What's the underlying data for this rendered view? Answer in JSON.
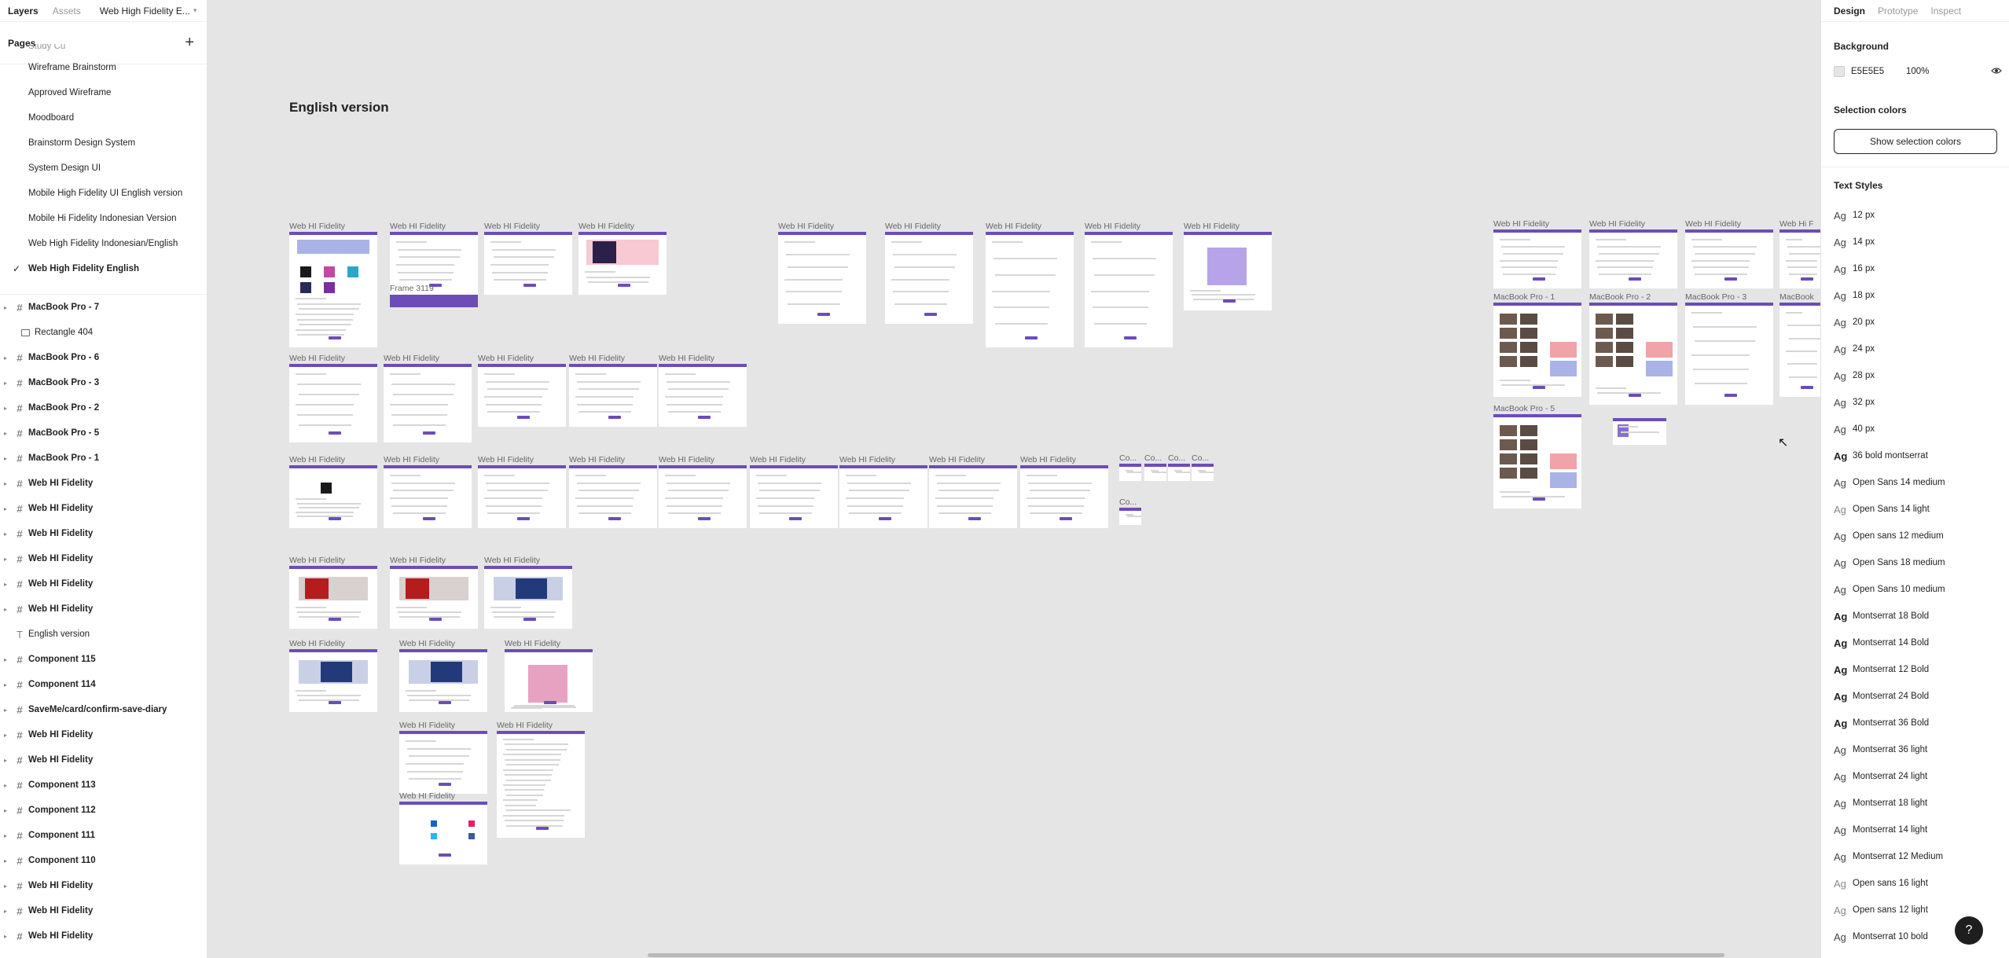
{
  "left_panel": {
    "tabs": [
      "Layers",
      "Assets"
    ],
    "file_name": "Web High Fidelity E...",
    "pages_title": "Pages",
    "pages": [
      {
        "label": "Study Cu",
        "clipped": true
      },
      {
        "label": "Wireframe Brainstorm"
      },
      {
        "label": "Approved Wireframe"
      },
      {
        "label": "Moodboard"
      },
      {
        "label": "Brainstorm Design System"
      },
      {
        "label": "System Design UI"
      },
      {
        "label": "Mobile High Fidelity UI English version"
      },
      {
        "label": "Mobile Hi Fidelity Indonesian Version"
      },
      {
        "label": "Web High Fidelity Indonesian/English"
      },
      {
        "label": "Web High Fidelity English",
        "active": true
      }
    ],
    "layers": [
      {
        "label": "MacBook Pro - 7",
        "type": "frame"
      },
      {
        "label": "Rectangle 404",
        "type": "rect",
        "child": true
      },
      {
        "label": "MacBook Pro - 6",
        "type": "frame"
      },
      {
        "label": "MacBook Pro - 3",
        "type": "frame"
      },
      {
        "label": "MacBook Pro - 2",
        "type": "frame"
      },
      {
        "label": "MacBook Pro - 5",
        "type": "frame"
      },
      {
        "label": "MacBook Pro - 1",
        "type": "frame"
      },
      {
        "label": "Web HI Fidelity",
        "type": "frame"
      },
      {
        "label": "Web HI Fidelity",
        "type": "frame"
      },
      {
        "label": "Web HI Fidelity",
        "type": "frame"
      },
      {
        "label": "Web HI Fidelity",
        "type": "frame"
      },
      {
        "label": "Web HI Fidelity",
        "type": "frame"
      },
      {
        "label": "Web HI Fidelity",
        "type": "frame"
      },
      {
        "label": "English version",
        "type": "text"
      },
      {
        "label": "Component 115",
        "type": "frame"
      },
      {
        "label": "Component 114",
        "type": "frame"
      },
      {
        "label": "SaveMe/card/confirm-save-diary",
        "type": "frame"
      },
      {
        "label": "Web HI Fidelity",
        "type": "frame"
      },
      {
        "label": "Web HI Fidelity",
        "type": "frame"
      },
      {
        "label": "Component 113",
        "type": "frame"
      },
      {
        "label": "Component 112",
        "type": "frame"
      },
      {
        "label": "Component 111",
        "type": "frame"
      },
      {
        "label": "Component 110",
        "type": "frame"
      },
      {
        "label": "Web HI Fidelity",
        "type": "frame"
      },
      {
        "label": "Web HI Fidelity",
        "type": "frame"
      },
      {
        "label": "Web HI Fidelity",
        "type": "frame"
      }
    ]
  },
  "canvas": {
    "title": "English version",
    "frame_3119_label": "Frame 3119",
    "frames": [
      {
        "label": "Web HI Fidelity",
        "kind": "hero"
      },
      {
        "label": "Web HI Fidelity",
        "kind": "list"
      },
      {
        "label": "Web HI Fidelity",
        "kind": "form"
      },
      {
        "label": "Web HI Fidelity",
        "kind": "pink"
      },
      {
        "label": "Web HI Fidelity",
        "kind": "form"
      },
      {
        "label": "Web HI Fidelity",
        "kind": "form"
      },
      {
        "label": "Web HI Fidelity",
        "kind": "form"
      },
      {
        "label": "Web HI Fidelity",
        "kind": "form"
      },
      {
        "label": "Web HI Fidelity",
        "kind": "people"
      },
      {
        "label": "Web HI Fidelity",
        "kind": "form"
      },
      {
        "label": "Web HI Fidelity",
        "kind": "form"
      },
      {
        "label": "Web HI Fidelity",
        "kind": "text"
      },
      {
        "label": "Web HI Fidelity",
        "kind": "text"
      },
      {
        "label": "Web HI Fidelity",
        "kind": "text"
      },
      {
        "label": "Web HI Fidelity",
        "kind": "avatar"
      },
      {
        "label": "Web HI Fidelity",
        "kind": "text"
      },
      {
        "label": "Web HI Fidelity",
        "kind": "text"
      },
      {
        "label": "Web HI Fidelity",
        "kind": "form"
      },
      {
        "label": "Web HI Fidelity",
        "kind": "form"
      },
      {
        "label": "Web HI Fidelity",
        "kind": "form"
      },
      {
        "label": "Web HI Fidelity",
        "kind": "form"
      },
      {
        "label": "Web HI Fidelity",
        "kind": "text"
      },
      {
        "label": "Web HI Fidelity",
        "kind": "text"
      },
      {
        "label": "Co...",
        "kind": "mini"
      },
      {
        "label": "Co...",
        "kind": "mini"
      },
      {
        "label": "Co...",
        "kind": "mini"
      },
      {
        "label": "Co...",
        "kind": "mini"
      },
      {
        "label": "Co...",
        "kind": "mini"
      },
      {
        "label": "Web HI Fidelity",
        "kind": "red"
      },
      {
        "label": "Web HI Fidelity",
        "kind": "red"
      },
      {
        "label": "Web HI Fidelity",
        "kind": "blue"
      },
      {
        "label": "Web HI Fidelity",
        "kind": "blue"
      },
      {
        "label": "Web HI Fidelity",
        "kind": "blue"
      },
      {
        "label": "Web HI Fidelity",
        "kind": "pinkpeople"
      },
      {
        "label": "Web HI Fidelity",
        "kind": "text"
      },
      {
        "label": "Web HI Fidelity",
        "kind": "doc"
      },
      {
        "label": "Web HI Fidelity",
        "kind": "social"
      },
      {
        "label": "Web HI Fidelity",
        "kind": "form"
      },
      {
        "label": "Web HI Fidelity",
        "kind": "form"
      },
      {
        "label": "Web HI Fidelity",
        "kind": "form"
      },
      {
        "label": "Web Hi F",
        "kind": "form"
      },
      {
        "label": "MacBook Pro - 1",
        "kind": "cards"
      },
      {
        "label": "MacBook Pro - 2",
        "kind": "cards"
      },
      {
        "label": "MacBook Pro - 3",
        "kind": "form"
      },
      {
        "label": "MacBook",
        "kind": "form"
      },
      {
        "label": "MacBook Pro - 5",
        "kind": "cards"
      },
      {
        "label": "",
        "kind": "modal"
      }
    ]
  },
  "right_panel": {
    "tabs": [
      "Design",
      "Prototype",
      "Inspect"
    ],
    "background_title": "Background",
    "background_hex": "E5E5E5",
    "background_opacity": "100%",
    "selection_colors_title": "Selection colors",
    "show_selection_colors": "Show selection colors",
    "text_styles_title": "Text Styles",
    "text_styles": [
      {
        "label": "12 px",
        "weight": "regular"
      },
      {
        "label": "14 px",
        "weight": "regular"
      },
      {
        "label": "16 px",
        "weight": "regular"
      },
      {
        "label": "18 px",
        "weight": "regular"
      },
      {
        "label": "20 px",
        "weight": "regular"
      },
      {
        "label": "24 px",
        "weight": "regular"
      },
      {
        "label": "28 px",
        "weight": "regular"
      },
      {
        "label": "32 px",
        "weight": "regular"
      },
      {
        "label": "40 px",
        "weight": "regular"
      },
      {
        "label": "36 bold montserrat",
        "weight": "bold"
      },
      {
        "label": "Open Sans 14 medium",
        "weight": "regular"
      },
      {
        "label": "Open Sans 14 light",
        "weight": "light"
      },
      {
        "label": "Open sans 12 medium",
        "weight": "regular"
      },
      {
        "label": "Open Sans 18 medium",
        "weight": "regular"
      },
      {
        "label": "Open Sans 10 medium",
        "weight": "regular"
      },
      {
        "label": "Montserrat 18 Bold",
        "weight": "bold"
      },
      {
        "label": "Montserrat 14 Bold",
        "weight": "bold"
      },
      {
        "label": "Montserrat 12 Bold",
        "weight": "bold"
      },
      {
        "label": "Montserrat 24 Bold",
        "weight": "bold"
      },
      {
        "label": "Montserrat 36 Bold",
        "weight": "bold"
      },
      {
        "label": "Montserrat 36 light",
        "weight": "regular"
      },
      {
        "label": "Montserrat 24 light",
        "weight": "regular"
      },
      {
        "label": "Montserrat 18 light",
        "weight": "regular"
      },
      {
        "label": "Montserrat 14 light",
        "weight": "regular"
      },
      {
        "label": "Montserrat 12 Medium",
        "weight": "regular"
      },
      {
        "label": "Open sans 16 light",
        "weight": "light"
      },
      {
        "label": "Open sans 12 light",
        "weight": "light"
      },
      {
        "label": "Montserrat 10 bold",
        "weight": "regular"
      }
    ],
    "help_label": "?"
  },
  "colors": {
    "canvas_bg": "#e5e5e5",
    "accent_purple": "#6c4db8"
  },
  "icons": {
    "frame": "hash-frame-icon",
    "text": "text-t-icon",
    "rect": "rectangle-icon",
    "check": "checkmark-icon",
    "add": "plus-icon",
    "eye": "eye-icon",
    "help": "question-mark-icon"
  }
}
